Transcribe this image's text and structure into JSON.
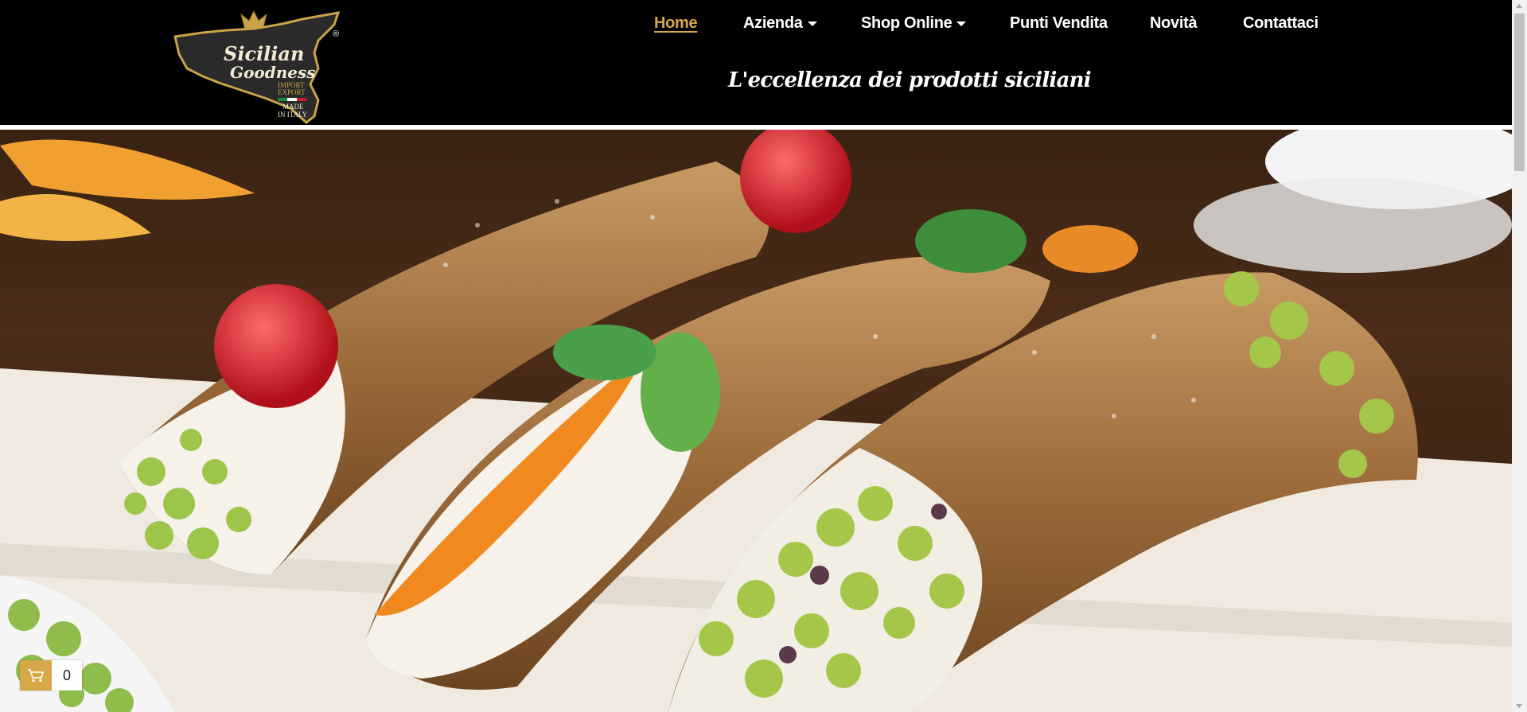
{
  "brand": {
    "logo_line1": "Sicilian",
    "logo_line2": "Goodness",
    "logo_sub1": "IMPORT",
    "logo_sub2": "EXPORT",
    "logo_sub3": "MADE",
    "logo_sub4": "IN ITALY",
    "registered": "®"
  },
  "nav": {
    "items": [
      {
        "label": "Home",
        "active": true
      },
      {
        "label": "Azienda",
        "dropdown": true
      },
      {
        "label": "Shop Online",
        "dropdown": true
      },
      {
        "label": "Punti Vendita"
      },
      {
        "label": "Novità"
      },
      {
        "label": "Contattaci"
      }
    ]
  },
  "tagline": "L'eccellenza dei prodotti siciliani",
  "cart": {
    "count": "0"
  },
  "colors": {
    "header_bg": "#000000",
    "accent_gold": "#d6a84a",
    "nav_text": "#ffffff"
  },
  "icons": [
    "crown-icon",
    "cart-icon",
    "caret-down-icon"
  ]
}
